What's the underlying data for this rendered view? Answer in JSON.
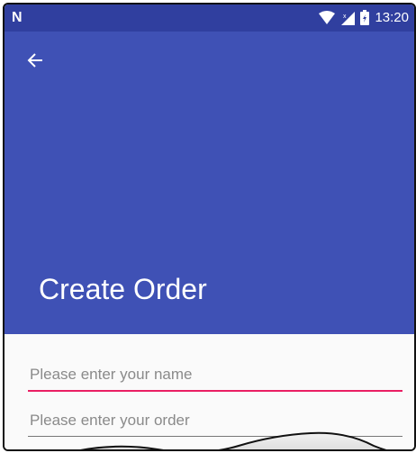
{
  "status_bar": {
    "left_glyph": "N",
    "time": "13:20",
    "icons": [
      "wifi-icon",
      "signal-icon",
      "battery-icon"
    ]
  },
  "app_bar": {
    "back_icon": "arrow-back-icon",
    "title": "Create Order",
    "color": "#3f51b5",
    "status_color": "#303f9f"
  },
  "form": {
    "name_placeholder": "Please enter your name",
    "name_value": "",
    "order_placeholder": "Please enter your order",
    "order_value": "",
    "focus_color": "#e91e63"
  }
}
